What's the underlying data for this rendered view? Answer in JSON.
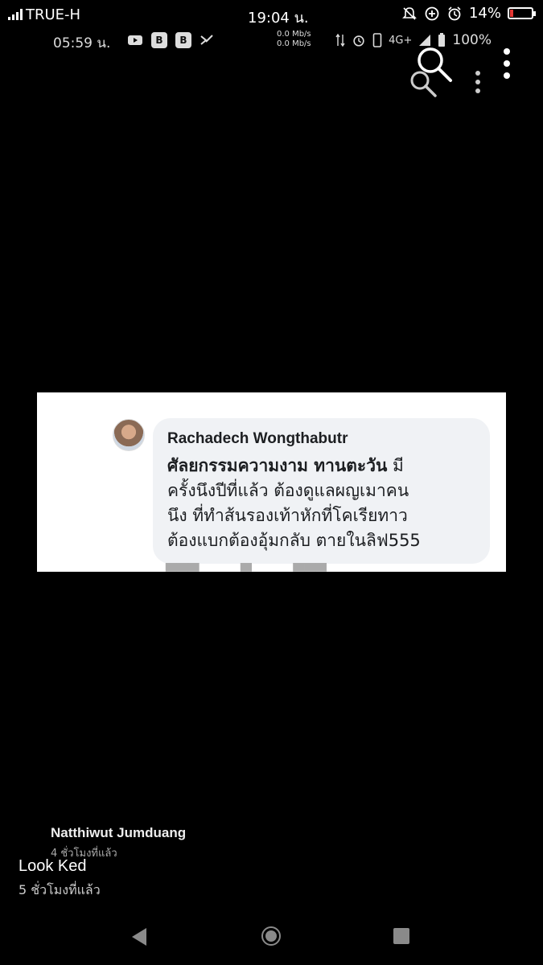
{
  "status_bar": {
    "carrier": "TRUE-H",
    "time": "19:04 น.",
    "battery": "14%"
  },
  "inner_status_bar": {
    "time": "05:59 น.",
    "speed_up": "0.0 Mb/s",
    "speed_down": "0.0 Mb/s",
    "network": "4G+",
    "battery": "100%"
  },
  "comment": {
    "author": "Rachadech Wongthabutr",
    "bold_text": "ศัลยกรรมความงาม ทานตะวัน",
    "lines": [
      " มี",
      "ครั้งนึงปีที่แล้ว ต้องดูแลผญเมาคน",
      "นึง ที่ทำส้นรองเท้าหักที่โคเรียทาว",
      "ต้องแบกต้องอุ้มกลับ ตายในลิฟ555"
    ]
  },
  "posts": [
    {
      "name": "Natthiwut Jumduang",
      "time": "4 ชั่วโมงที่แล้ว"
    },
    {
      "name": "Look Ked",
      "time": "5 ชั่วโมงที่แล้ว"
    }
  ],
  "icons": [
    "signal-icon",
    "muted-bell-icon",
    "data-saver-icon",
    "alarm-icon",
    "battery-icon",
    "search-icon",
    "more-icon",
    "back-icon",
    "home-icon",
    "recents-icon"
  ],
  "colors": {
    "background": "#000000",
    "battery_low": "#e53935",
    "bubble": "#f0f2f5"
  }
}
